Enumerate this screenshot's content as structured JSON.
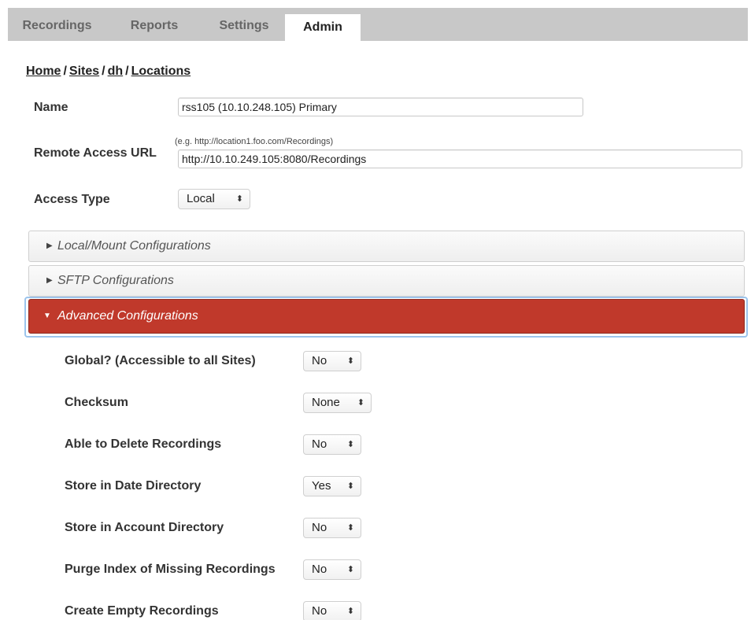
{
  "tabs": [
    {
      "label": "Recordings"
    },
    {
      "label": "Reports"
    },
    {
      "label": "Settings"
    },
    {
      "label": "Admin"
    }
  ],
  "active_tab": "Admin",
  "breadcrumb": {
    "home": "Home",
    "sites": "Sites",
    "site": "dh",
    "locations": "Locations",
    "separator": "/"
  },
  "form": {
    "name_label": "Name",
    "name_value": "rss105 (10.10.248.105) Primary",
    "remote_label": "Remote Access URL",
    "remote_hint": "(e.g. http://location1.foo.com/Recordings)",
    "remote_value": "http://10.10.249.105:8080/Recordings",
    "access_label": "Access Type",
    "access_value": "Local"
  },
  "panels": {
    "local_mount": "Local/Mount Configurations",
    "sftp": "SFTP Configurations",
    "advanced": "Advanced Configurations"
  },
  "advanced": [
    {
      "label": "Global? (Accessible to all Sites)",
      "value": "No"
    },
    {
      "label": "Checksum",
      "value": "None"
    },
    {
      "label": "Able to Delete Recordings",
      "value": "No"
    },
    {
      "label": "Store in Date Directory",
      "value": "Yes"
    },
    {
      "label": "Store in Account Directory",
      "value": "No"
    },
    {
      "label": "Purge Index of Missing Recordings",
      "value": "No"
    },
    {
      "label": "Create Empty Recordings",
      "value": "No"
    }
  ],
  "icons": {
    "select_arrows": "updown-arrows-icon",
    "collapsed": "caret-right-icon",
    "expanded": "caret-down-icon"
  },
  "colors": {
    "active_panel": "#c0392b",
    "tabbar": "#c8c8c8"
  }
}
